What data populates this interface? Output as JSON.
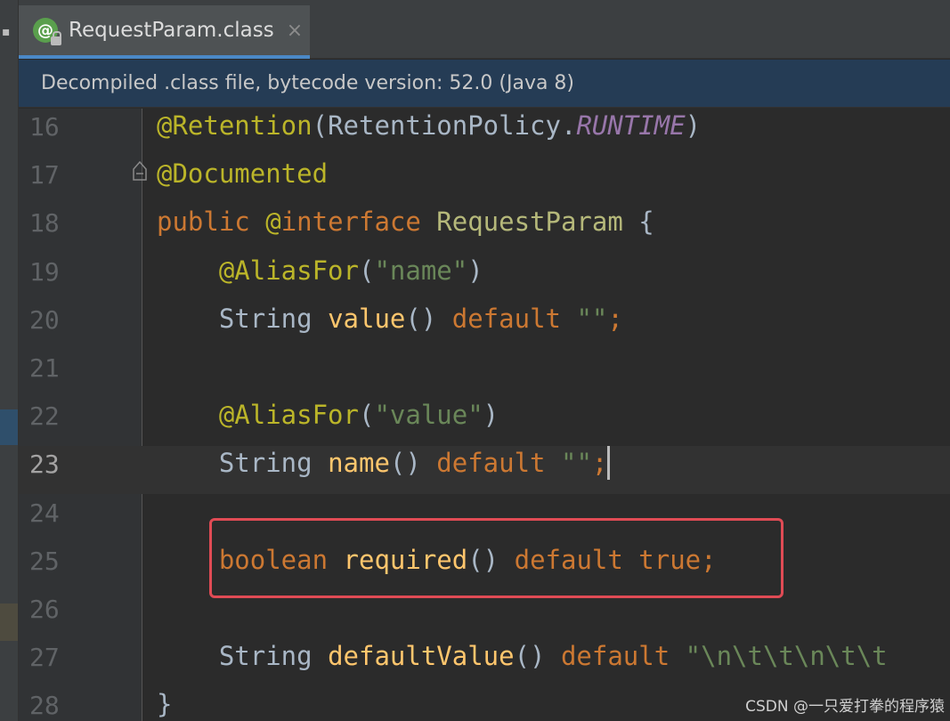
{
  "tab": {
    "icon_glyph": "@",
    "label": "RequestParam.class",
    "close_glyph": "×"
  },
  "banner": {
    "text": "Decompiled .class file, bytecode version: 52.0 (Java 8)"
  },
  "editor": {
    "current_line": 23,
    "lines": [
      {
        "num": "16",
        "tokens": [
          {
            "t": "@Retention",
            "c": "ann"
          },
          {
            "t": "(",
            "c": "cls"
          },
          {
            "t": "RetentionPolicy",
            "c": "cls"
          },
          {
            "t": ".",
            "c": "cls"
          },
          {
            "t": "RUNTIME",
            "c": "const"
          },
          {
            "t": ")",
            "c": "cls"
          }
        ]
      },
      {
        "num": "17",
        "tokens": [
          {
            "t": "@Documented",
            "c": "ann"
          }
        ]
      },
      {
        "num": "18",
        "tokens": [
          {
            "t": "public ",
            "c": "kw"
          },
          {
            "t": "@",
            "c": "ann"
          },
          {
            "t": "interface ",
            "c": "kw"
          },
          {
            "t": "RequestParam",
            "c": "tp"
          },
          {
            "t": " {",
            "c": "cls"
          }
        ]
      },
      {
        "num": "19",
        "tokens": [
          {
            "t": "    ",
            "c": "cls"
          },
          {
            "t": "@AliasFor",
            "c": "ann"
          },
          {
            "t": "(",
            "c": "cls"
          },
          {
            "t": "\"name\"",
            "c": "str"
          },
          {
            "t": ")",
            "c": "cls"
          }
        ]
      },
      {
        "num": "20",
        "tokens": [
          {
            "t": "    ",
            "c": "cls"
          },
          {
            "t": "String ",
            "c": "cls"
          },
          {
            "t": "value",
            "c": "fn"
          },
          {
            "t": "() ",
            "c": "cls"
          },
          {
            "t": "default ",
            "c": "kw"
          },
          {
            "t": "\"\"",
            "c": "str"
          },
          {
            "t": ";",
            "c": "kw"
          }
        ]
      },
      {
        "num": "21",
        "tokens": []
      },
      {
        "num": "22",
        "tokens": [
          {
            "t": "    ",
            "c": "cls"
          },
          {
            "t": "@AliasFor",
            "c": "ann"
          },
          {
            "t": "(",
            "c": "cls"
          },
          {
            "t": "\"value\"",
            "c": "str"
          },
          {
            "t": ")",
            "c": "cls"
          }
        ]
      },
      {
        "num": "23",
        "tokens": [
          {
            "t": "    ",
            "c": "cls"
          },
          {
            "t": "String ",
            "c": "cls"
          },
          {
            "t": "name",
            "c": "fn"
          },
          {
            "t": "() ",
            "c": "cls"
          },
          {
            "t": "default ",
            "c": "kw"
          },
          {
            "t": "\"\"",
            "c": "str"
          },
          {
            "t": ";",
            "c": "kw"
          }
        ]
      },
      {
        "num": "24",
        "tokens": []
      },
      {
        "num": "25",
        "tokens": [
          {
            "t": "    ",
            "c": "cls"
          },
          {
            "t": "boolean ",
            "c": "kw"
          },
          {
            "t": "required",
            "c": "fn"
          },
          {
            "t": "() ",
            "c": "cls"
          },
          {
            "t": "default ",
            "c": "kw"
          },
          {
            "t": "true",
            "c": "kw"
          },
          {
            "t": ";",
            "c": "kw"
          }
        ]
      },
      {
        "num": "26",
        "tokens": []
      },
      {
        "num": "27",
        "tokens": [
          {
            "t": "    ",
            "c": "cls"
          },
          {
            "t": "String ",
            "c": "cls"
          },
          {
            "t": "defaultValue",
            "c": "fn"
          },
          {
            "t": "() ",
            "c": "cls"
          },
          {
            "t": "default ",
            "c": "kw"
          },
          {
            "t": "\"\\n\\t\\t\\n\\t\\t",
            "c": "str"
          }
        ]
      },
      {
        "num": "28",
        "tokens": [
          {
            "t": "}",
            "c": "cls"
          }
        ]
      }
    ]
  },
  "watermark": "CSDN @一只爱打拳的程序猿",
  "colors": {
    "highlight_box": "#e04b55",
    "tab_underline": "#4a88c7",
    "banner_bg": "#253c55"
  }
}
